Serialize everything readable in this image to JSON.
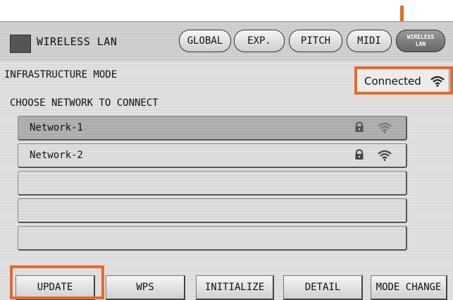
{
  "header": {
    "title": "WIRELESS LAN",
    "tabs": [
      {
        "label": "GLOBAL"
      },
      {
        "label": "EXP."
      },
      {
        "label": "PITCH"
      },
      {
        "label": "MIDI"
      },
      {
        "label_line1": "WIRELESS",
        "label_line2": "LAN",
        "active": true
      }
    ]
  },
  "mode": {
    "label": "INFRASTRUCTURE MODE"
  },
  "status": {
    "text": "Connected",
    "icon": "wifi-icon"
  },
  "network_list": {
    "heading": "CHOOSE NETWORK TO CONNECT",
    "items": [
      {
        "name": "Network-1",
        "locked": true,
        "signal": "strong",
        "selected": true
      },
      {
        "name": "Network-2",
        "locked": true,
        "signal": "strong",
        "selected": false
      },
      {
        "name": "",
        "selected": false
      },
      {
        "name": "",
        "selected": false
      },
      {
        "name": "",
        "selected": false
      }
    ]
  },
  "buttons": {
    "update": "UPDATE",
    "wps": "WPS",
    "initialize": "INITIALIZE",
    "detail": "DETAIL",
    "mode_change": "MODE CHANGE"
  },
  "colors": {
    "highlight": "#e66a2c",
    "background": "#dedede"
  }
}
